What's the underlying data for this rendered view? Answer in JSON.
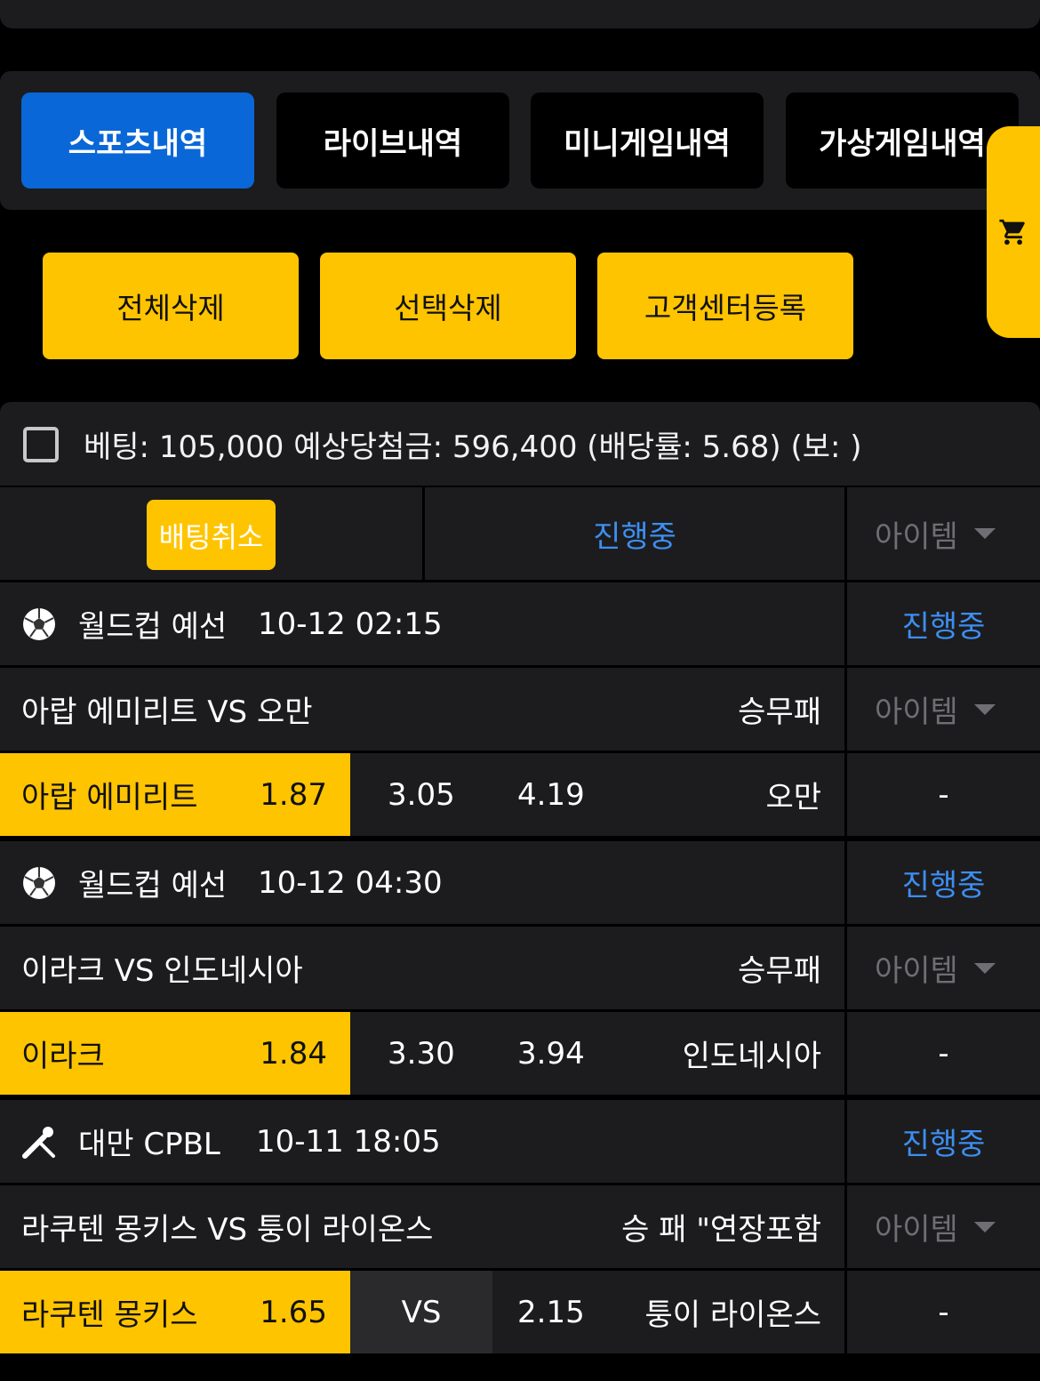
{
  "tabs": [
    {
      "label": "스포츠내역",
      "active": true
    },
    {
      "label": "라이브내역",
      "active": false
    },
    {
      "label": "미니게임내역",
      "active": false
    },
    {
      "label": "가상게임내역",
      "active": false
    }
  ],
  "actions": {
    "delete_all": "전체삭제",
    "delete_selected": "선택삭제",
    "register_support": "고객센터등록"
  },
  "summary": {
    "text": "베팅: 105,000 예상당첨금: 596,400 (배당률: 5.68) (보: )"
  },
  "bet_header": {
    "cancel_label": "배팅취소",
    "status": "진행중",
    "item_label": "아이템"
  },
  "games": [
    {
      "sport_icon": "soccer-ball-icon",
      "league": "월드컵 예선",
      "datetime": "10-12 02:15",
      "status": "진행중",
      "match": "아랍 에미리트 VS 오만",
      "market": "승무패",
      "item_label": "아이템",
      "home_team": "아랍 에미리트",
      "home_odds": "1.87",
      "draw": "3.05",
      "away_odds": "4.19",
      "away_team": "오만",
      "result": "-"
    },
    {
      "sport_icon": "soccer-ball-icon",
      "league": "월드컵 예선",
      "datetime": "10-12 04:30",
      "status": "진행중",
      "match": "이라크 VS 인도네시아",
      "market": "승무패",
      "item_label": "아이템",
      "home_team": "이라크",
      "home_odds": "1.84",
      "draw": "3.30",
      "away_odds": "3.94",
      "away_team": "인도네시아",
      "result": "-"
    },
    {
      "sport_icon": "baseball-icon",
      "league": "대만 CPBL",
      "datetime": "10-11 18:05",
      "status": "진행중",
      "match": "라쿠텐 몽키스 VS 퉁이 라이온스",
      "market": "승 패 \"연장포함",
      "item_label": "아이템",
      "home_team": "라쿠텐 몽키스",
      "home_odds": "1.65",
      "draw": "VS",
      "away_odds": "2.15",
      "away_team": "퉁이 라이온스",
      "result": "-"
    }
  ],
  "colors": {
    "accent_yellow": "#ffc400",
    "active_tab_blue": "#0a67d8",
    "status_blue": "#3d8ef0",
    "panel": "#1c1c1e"
  }
}
